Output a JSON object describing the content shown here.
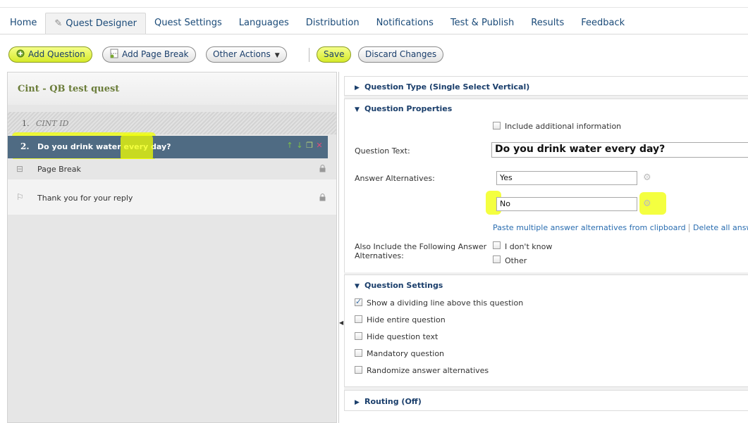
{
  "nav": {
    "tabs": [
      {
        "label": "Home"
      },
      {
        "label": "Quest Designer"
      },
      {
        "label": "Quest Settings"
      },
      {
        "label": "Languages"
      },
      {
        "label": "Distribution"
      },
      {
        "label": "Notifications"
      },
      {
        "label": "Test & Publish"
      },
      {
        "label": "Results"
      },
      {
        "label": "Feedback"
      }
    ],
    "active": "Quest Designer"
  },
  "toolbar": {
    "add_question": "Add Question",
    "add_page_break": "Add Page Break",
    "other_actions": "Other Actions",
    "save": "Save",
    "discard": "Discard Changes"
  },
  "left": {
    "title": "Cint - QB test quest",
    "questions": [
      {
        "num": "1.",
        "text": "CINT ID"
      },
      {
        "num": "2.",
        "text": "Do you drink water every day?"
      }
    ],
    "page_break": "Page Break",
    "thank_you": "Thank you for your reply"
  },
  "right": {
    "question_type": "Question Type (Single Select Vertical)",
    "question_properties": "Question Properties",
    "include_info": "Include additional information",
    "question_text_label": "Question Text:",
    "question_text_value": "Do you drink water every day?",
    "answer_alts_label": "Answer Alternatives:",
    "answers": [
      "Yes",
      "No"
    ],
    "paste_link": "Paste multiple answer alternatives from clipboard",
    "delete_link": "Delete all answ",
    "also_include_label_1": "Also Include the Following Answer",
    "also_include_label_2": "Alternatives:",
    "dont_know": "I don't know",
    "other": "Other",
    "question_settings": "Question Settings",
    "settings": [
      {
        "label": "Show a dividing line above this question",
        "checked": true
      },
      {
        "label": "Hide entire question",
        "checked": false
      },
      {
        "label": "Hide question text",
        "checked": false
      },
      {
        "label": "Mandatory question",
        "checked": false
      },
      {
        "label": "Randomize answer alternatives",
        "checked": false
      }
    ],
    "routing": "Routing (Off)"
  },
  "colors": {
    "highlight": "#f0ff00",
    "selected_row": "#4f6b83",
    "link": "#2a6db0",
    "title_green": "#6b7d3a"
  }
}
